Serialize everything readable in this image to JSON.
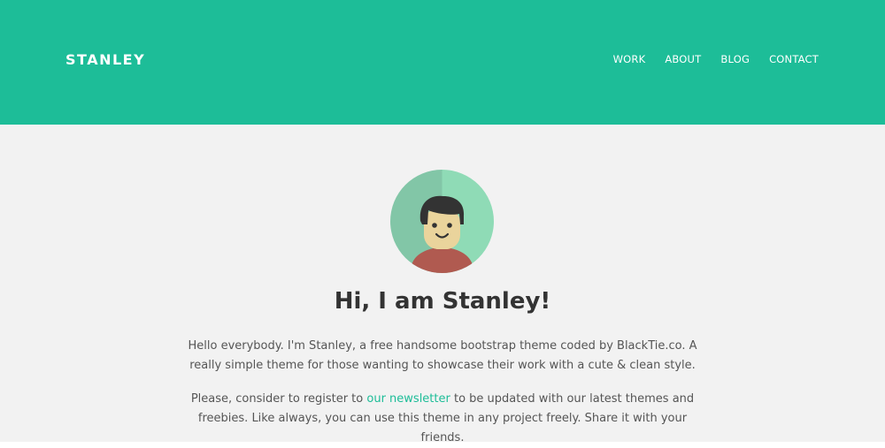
{
  "header": {
    "brand": "STANLEY",
    "nav": [
      "WORK",
      "ABOUT",
      "BLOG",
      "CONTACT"
    ]
  },
  "hero": {
    "avatar_icon": "person-avatar-icon",
    "title": "Hi, I am Stanley!",
    "paragraph1": "Hello everybody. I'm Stanley, a free handsome bootstrap theme coded by BlackTie.co. A really simple theme for those wanting to showcase their work with a cute & clean style.",
    "paragraph2_before": "Please, consider to register to ",
    "paragraph2_link": "our newsletter",
    "paragraph2_after": " to be updated with our latest themes and freebies. Like always, you can use this theme in any project freely. Share it with your friends."
  },
  "colors": {
    "accent": "#1dbd98",
    "background": "#f2f2f2",
    "title_text": "#333333",
    "body_text": "#555555"
  }
}
